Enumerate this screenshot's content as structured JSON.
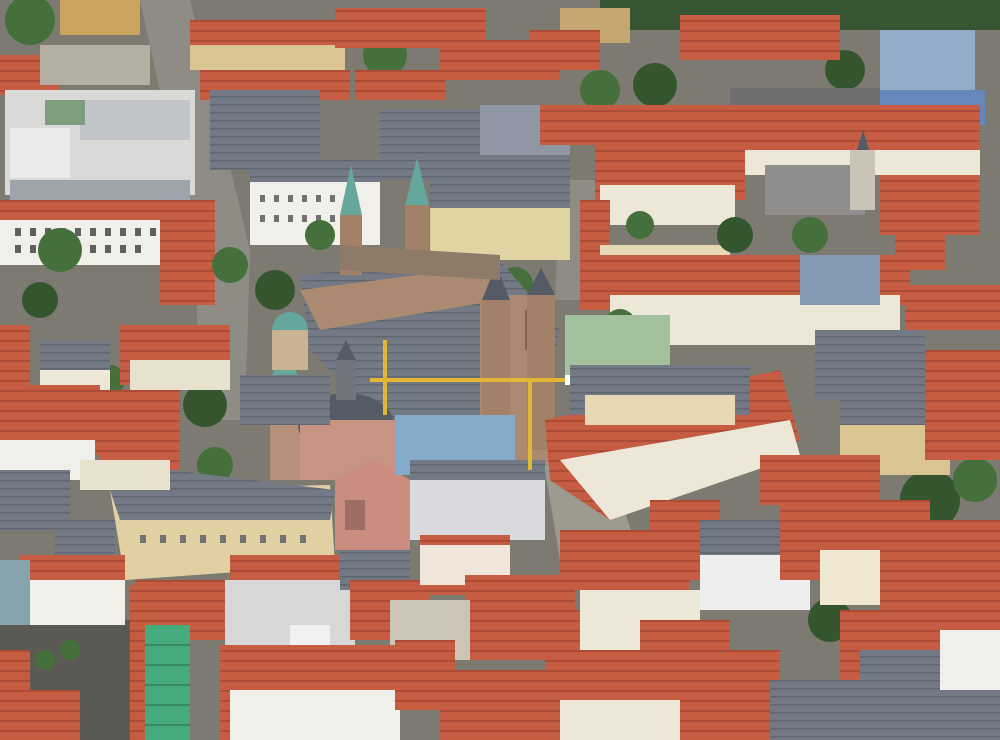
{
  "image": {
    "subject": "aerial-city-view",
    "palette": {
      "ground": "#6b6a62",
      "street": "#8a8880",
      "roof_red": "#c0553a",
      "roof_red_dark": "#9e4430",
      "roof_grey": "#6e7480",
      "roof_grey_dark": "#4f5560",
      "facade_light": "#e8e0cc",
      "facade_ochre": "#d9c28e",
      "facade_white": "#f1efe9",
      "cathedral_stone": "#a9866d",
      "dome_dark": "#4d555f",
      "dome_green": "#5fa39a",
      "crane_yellow": "#e1b52c",
      "tree_green": "#3e6b34",
      "tree_green_dark": "#2d4f27",
      "scaffold_green": "#3fa877",
      "glass_blue": "#7ea3c8"
    }
  }
}
